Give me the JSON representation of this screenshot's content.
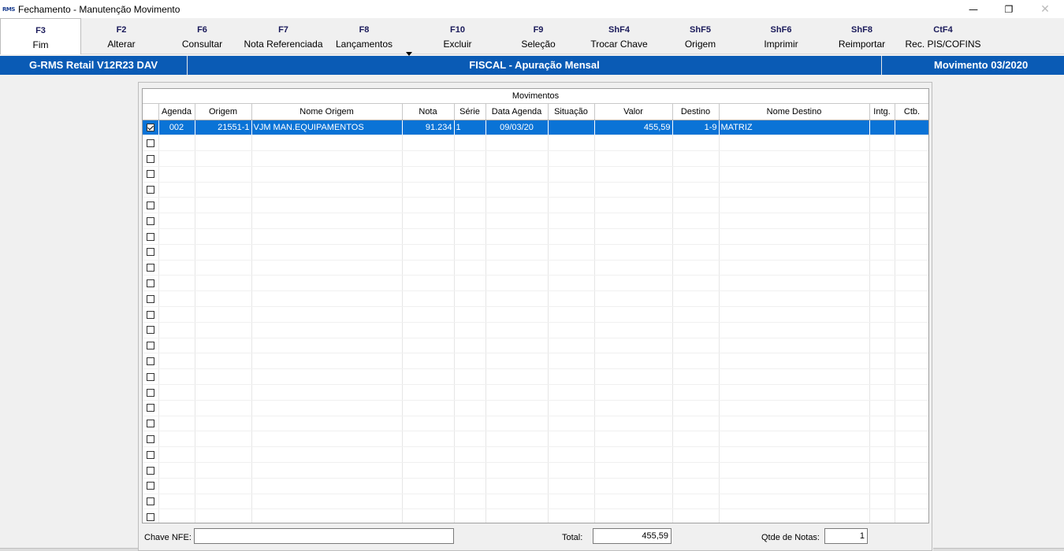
{
  "window": {
    "logo_text": "RMS",
    "title": "Fechamento - Manutenção Movimento",
    "minimize_glyph": "—",
    "restore_glyph": "❐",
    "close_glyph": "✕"
  },
  "toolbar": {
    "buttons": [
      {
        "key": "F3",
        "label": "Fim"
      },
      {
        "key": "F2",
        "label": "Alterar"
      },
      {
        "key": "F6",
        "label": "Consultar"
      },
      {
        "key": "F7",
        "label": "Nota Referenciada"
      },
      {
        "key": "F8",
        "label": "Lançamentos"
      },
      {
        "key": "F10",
        "label": "Excluir"
      },
      {
        "key": "F9",
        "label": "Seleção"
      },
      {
        "key": "ShF4",
        "label": "Trocar Chave"
      },
      {
        "key": "ShF5",
        "label": "Origem"
      },
      {
        "key": "ShF6",
        "label": "Imprimir"
      },
      {
        "key": "ShF8",
        "label": "Reimportar"
      },
      {
        "key": "CtF4",
        "label": "Rec. PIS/COFINS"
      }
    ]
  },
  "infobar": {
    "system": "G-RMS Retail V12R23 DAV",
    "module": "FISCAL - Apuração Mensal",
    "period": "Movimento 03/2020",
    "color": "#0a5bb5"
  },
  "grid": {
    "caption": "Movimentos",
    "columns": [
      "",
      "Agenda",
      "Origem",
      "Nome Origem",
      "Nota",
      "Série",
      "Data Agenda",
      "Situação",
      "Valor",
      "Destino",
      "Nome Destino",
      "Intg.",
      "Ctb."
    ],
    "rows": [
      {
        "checked": true,
        "agenda": "002",
        "origem": "21551-1",
        "nome_origem": "VJM MAN.EQUIPAMENTOS",
        "nota": "91.234",
        "serie": "1",
        "data_agenda": "09/03/20",
        "situacao": "",
        "valor": "455,59",
        "destino": "1-9",
        "nome_destino": "MATRIZ",
        "intg": "",
        "ctb": ""
      }
    ],
    "selection_color": "#0a73d6"
  },
  "footer": {
    "chave_nfe_label": "Chave NFE:",
    "chave_nfe_value": "",
    "total_label": "Total:",
    "total_value": "455,59",
    "qtde_label": "Qtde de Notas:",
    "qtde_value": "1"
  }
}
